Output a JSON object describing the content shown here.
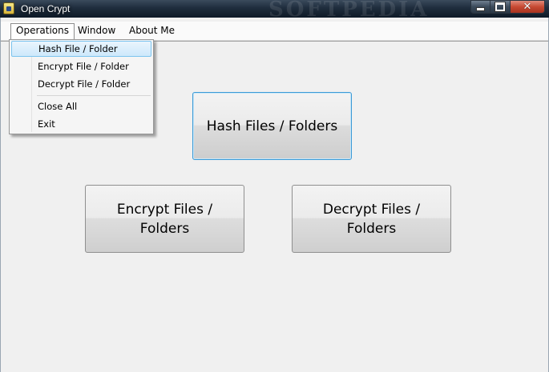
{
  "window": {
    "title": "Open Crypt",
    "watermark": "SOFTPEDIA",
    "controls": {
      "minimize": "",
      "maximize": "",
      "close": "✕"
    }
  },
  "menubar": {
    "items": [
      {
        "label": "Operations"
      },
      {
        "label": "Window"
      },
      {
        "label": "About Me"
      }
    ]
  },
  "dropdown": {
    "items": [
      {
        "label": "Hash File / Folder"
      },
      {
        "label": "Encrypt File / Folder"
      },
      {
        "label": "Decrypt File / Folder"
      },
      {
        "label": "Close All"
      },
      {
        "label": "Exit"
      }
    ]
  },
  "buttons": {
    "hash": "Hash Files / Folders",
    "encrypt": "Encrypt Files / Folders",
    "decrypt": "Decrypt Files / Folders"
  },
  "colors": {
    "accent_focus": "#3c9ad6",
    "menu_hover": "#cde8fb",
    "close_button": "#c64a33"
  },
  "icons": {
    "app": "app-icon",
    "minimize": "minimize-icon",
    "maximize": "maximize-icon",
    "close": "close-icon"
  }
}
